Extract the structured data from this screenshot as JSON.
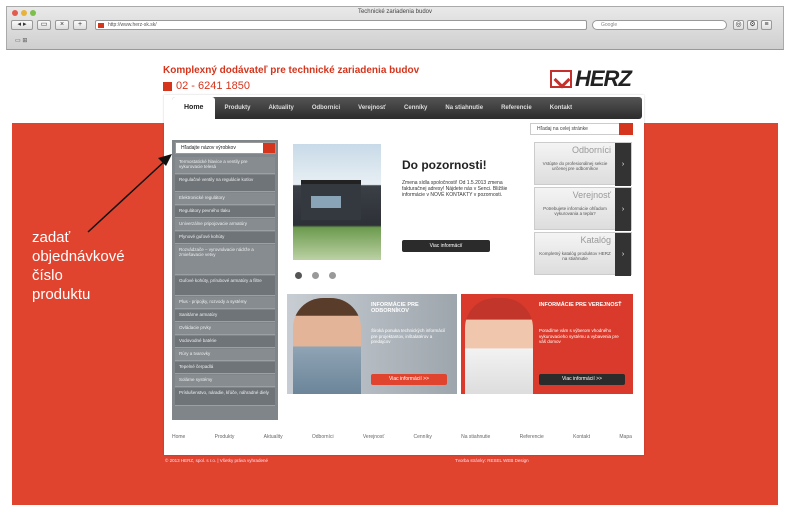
{
  "browser": {
    "title": "Technické zariadenia budov",
    "url": "http://www.herz-sk.sk/",
    "search_placeholder": "Google",
    "bookmark_icons": "▭ ⊞"
  },
  "site": {
    "tagline": "Komplexný dodávateľ pre technické zariadenia budov",
    "phone": "02 - 6241 1850",
    "logo_text": "HERZ",
    "brand_color": "#d4351c"
  },
  "menu": {
    "items": [
      "Home",
      "Produkty",
      "Aktuality",
      "Odborníci",
      "Verejnosť",
      "Cenníky",
      "Na stiahnutie",
      "Referencie",
      "Kontakt"
    ]
  },
  "search": {
    "placeholder": "Hľadaj na celej stránke"
  },
  "sidebar": {
    "input_placeholder": "Hľadajte názov výrobkov",
    "items": [
      "Termostatické hlavice a ventily pre vykurovacie telesá",
      "Regulačné ventily na regulácie kotlov",
      "Elektronické regulátory",
      "Regulátory pevného tlaku",
      "Univerzálne pripojovacie armatúry",
      "Plynové guľové kohúty",
      "Rozvádzače – vyrovnávacie nádrže a zmiešavacie vetvy",
      "Guľové kohúty, prírubové armatúry a filtre",
      "Plus - pripojky, rozvody a systémy",
      "Sanitárne armatúry",
      "Ovládacie prvky",
      "Vodovodné batérie",
      "Rúry a tvarovky",
      "Tepelné čerpadlá",
      "Solárne systémy",
      "Príslušenstvo, náradie, kľúče, náhradné diely"
    ]
  },
  "slide": {
    "title": "Do pozornosti!",
    "text": "Zmena sídla spoločnosti! Od 1.5.2013 zmena fakturačnej adresy! Nájdete nás v Senci. Bližšie informácie v NOVÉ KONTAKTY v pozornosti.",
    "button": "Viac informácií"
  },
  "tabs": [
    {
      "title": "Odborníci",
      "text": "Vstúpte do profesionálnej sekcie určenej pre odborníkov"
    },
    {
      "title": "Verejnosť",
      "text": "Potrebujete informácie ohľadom vykurovania a tepla?"
    },
    {
      "title": "Katalóg",
      "text": "Kompletný katalóg produktov HERZ na stiahnutie"
    }
  ],
  "promos": [
    {
      "title": "INFORMÁCIE PRE ODBORNÍKOV",
      "text": "Široká ponuka technických informácií pre projektantov, inštalatérov a predajcov",
      "button": "Viac informácií >>"
    },
    {
      "title": "INFORMÁCIE PRE VEREJNOSŤ",
      "text": "Poradíme vám s výberom vhodného vykurovacieho systému a vybavenia pre váš domov",
      "button": "Viac informácií >>"
    }
  ],
  "footer": {
    "links": [
      "Home",
      "Produkty",
      "Aktuality",
      "Odborníci",
      "Verejnosť",
      "Cenníky",
      "Na stiahnutie",
      "Referencie",
      "Kontakt",
      "Mapa"
    ],
    "copyright": "© 2013 HERZ, spol. s r.o. | Všetky práva vyhradené",
    "credits": "Tvorba stránky: RESEL WEB Design"
  },
  "annotation": {
    "lines": [
      "zadať",
      "objednávkové",
      "číslo",
      "produktu"
    ]
  }
}
